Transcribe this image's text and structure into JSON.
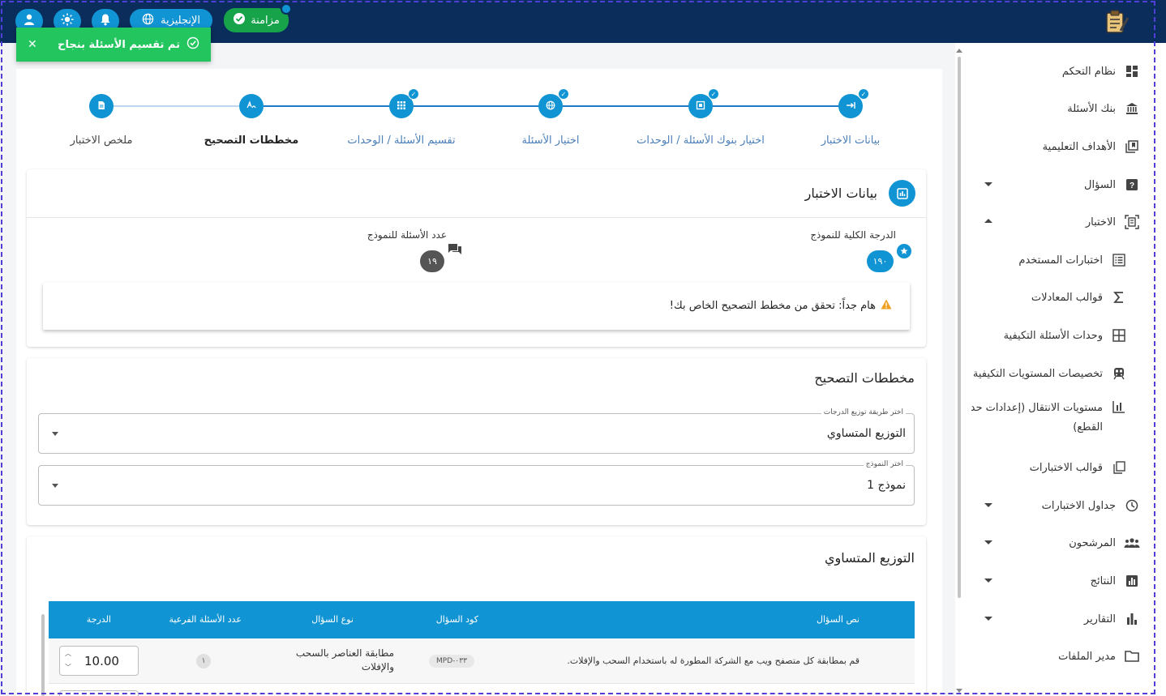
{
  "topbar": {
    "sync_label": "مزامنة",
    "language_label": "الإنجليزية"
  },
  "toast": {
    "message": "تم تقسيم الأسئلة بنجاح",
    "close": "✕"
  },
  "sidebar": {
    "items": [
      {
        "label": "نظام التحكم",
        "icon": "dashboard-icon"
      },
      {
        "label": "بنك الأسئلة",
        "icon": "bank-icon"
      },
      {
        "label": "الأهداف التعليمية",
        "icon": "objectives-icon"
      },
      {
        "label": "السؤال",
        "icon": "question-icon",
        "expand": "down"
      },
      {
        "label": "الاختبار",
        "icon": "exam-icon",
        "expand": "up"
      },
      {
        "label": "اختبارات المستخدم",
        "icon": "list-icon"
      },
      {
        "label": "قوالب المعادلات",
        "icon": "sigma-icon"
      },
      {
        "label": "وحدات الأسئلة التكيفية",
        "icon": "grid-icon"
      },
      {
        "label": "تخصيصات المستويات التكيفية",
        "icon": "train-icon"
      },
      {
        "label": "مستويات الانتقال (إعدادات حد",
        "label2": "القطع)",
        "icon": "bar-icon"
      },
      {
        "label": "قوالب الاختبارات",
        "icon": "copy-icon"
      },
      {
        "label": "جداول الاختبارات",
        "icon": "clock-icon",
        "expand": "down"
      },
      {
        "label": "المرشحون",
        "icon": "people-icon",
        "expand": "down"
      },
      {
        "label": "النتائج",
        "icon": "chart-box-icon",
        "expand": "down"
      },
      {
        "label": "التقارير",
        "icon": "bar-chart-icon",
        "expand": "down"
      },
      {
        "label": "مدير الملفات",
        "icon": "folder-icon"
      }
    ]
  },
  "stepper": {
    "steps": [
      {
        "label": "بيانات الاختبار",
        "state": "done"
      },
      {
        "label": "اختيار بنوك الأسئلة / الوحدات",
        "state": "done"
      },
      {
        "label": "اختيار الأسئلة",
        "state": "done"
      },
      {
        "label": "تقسيم الأسئلة / الوحدات",
        "state": "done"
      },
      {
        "label": "مخططات التصحيح",
        "state": "active"
      },
      {
        "label": "ملخص الاختبار",
        "state": "pending"
      }
    ]
  },
  "exam_data": {
    "title": "بيانات الاختبار",
    "total_grade_label": "الدرجة الكلية للنموذج",
    "total_grade_value": "١٩٠",
    "question_count_label": "عدد الأسئلة للنموذج",
    "question_count_value": "١٩",
    "warning": "هام جداً: تحقق من مخطط التصحيح الخاص بك!"
  },
  "grading": {
    "title": "مخططات التصحيح",
    "method_legend": "اختر طريقة توزيع الدرجات",
    "method_value": "التوزيع المتساوي",
    "model_legend": "اختر النموذج",
    "model_value": "نموذج 1"
  },
  "distribution": {
    "title": "التوزيع المتساوي",
    "columns": [
      "نص السؤال",
      "كود السؤال",
      "نوع السؤال",
      "عدد الأسئلة الفرعية",
      "الدرجة"
    ],
    "rows": [
      {
        "text": "قم بمطابقة كل متصفح ويب مع الشركة المطورة له باستخدام السحب والإفلات.",
        "code": "MPD-٠٣٣",
        "type_line1": "مطابقة العناصر بالسحب",
        "type_line2": "والإفلات",
        "sub_count": "١",
        "grade": "10.00"
      }
    ]
  },
  "colors": {
    "topbar": "#0b2d5b",
    "accent": "#1194d3",
    "success": "#22c55e",
    "step_line": "#1f78c8"
  }
}
